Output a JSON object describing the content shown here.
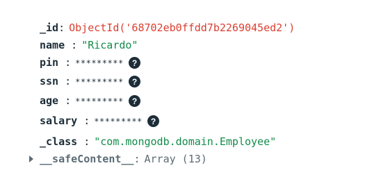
{
  "document": {
    "fields": [
      {
        "key": "_id",
        "value": "ObjectId('68702eb0ffdd7b2269045ed2')"
      },
      {
        "key": "name",
        "value": "\"Ricardo\""
      },
      {
        "key": "pin",
        "value": "*********",
        "encrypted": true
      },
      {
        "key": "ssn",
        "value": "*********",
        "encrypted": true
      },
      {
        "key": "age",
        "value": "*********",
        "encrypted": true
      },
      {
        "key": "salary",
        "value": "*********",
        "encrypted": true
      },
      {
        "key": "_class",
        "value": "\"com.mongodb.domain.Employee\""
      }
    ],
    "collapsed_field": {
      "key": "__safeContent__",
      "value": "Array (13)",
      "expand_icon": "caret-right-icon"
    },
    "help_icon": "question-circle-icon"
  },
  "colors": {
    "key": "#1c2d38",
    "objectid": "#db3e2f",
    "string": "#128c4a",
    "muted": "#5c6c75"
  }
}
